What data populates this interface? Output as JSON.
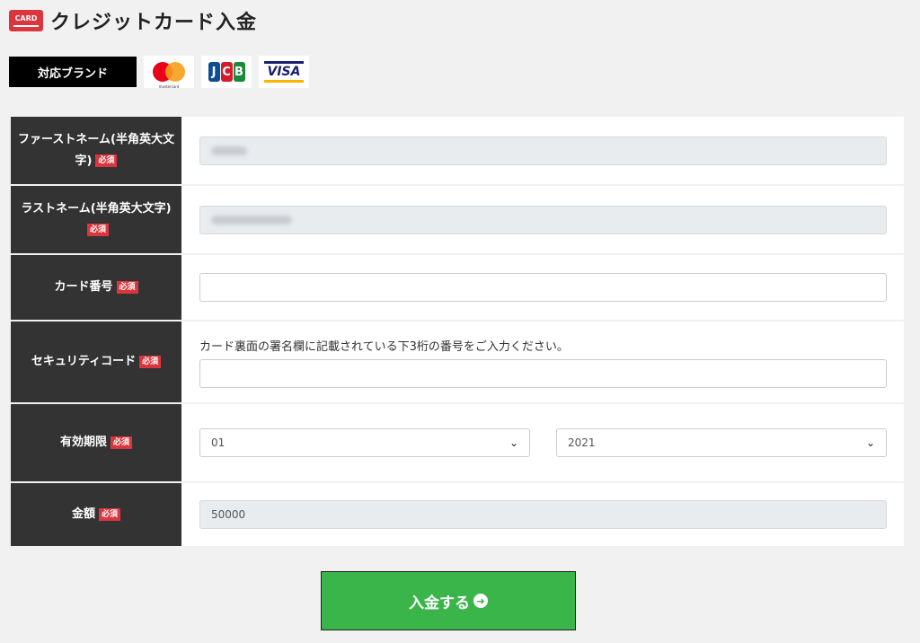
{
  "header": {
    "icon_text": "CARD",
    "title": "クレジットカード入金"
  },
  "brands": {
    "label": "対応ブランド",
    "logos": [
      "mastercard-logo",
      "jcb-logo",
      "visa-logo"
    ],
    "mastercard_text": "mastercard",
    "jcb_text": [
      "J",
      "C",
      "B"
    ],
    "visa_text": "VISA"
  },
  "required": "必須",
  "form": {
    "first_name": {
      "label": "ファーストネーム(半角英大文字)"
    },
    "last_name": {
      "label": "ラストネーム(半角英大文字)"
    },
    "card_number": {
      "label": "カード番号",
      "value": ""
    },
    "security_code": {
      "label": "セキュリティコード",
      "help": "カード裏面の署名欄に記載されている下3桁の番号をご入力ください。",
      "value": ""
    },
    "expiry": {
      "label": "有効期限",
      "month": "01",
      "year": "2021"
    },
    "amount": {
      "label": "金額",
      "value": "50000"
    }
  },
  "submit": {
    "label": "入金する"
  },
  "colors": {
    "accent_red": "#d9363e",
    "label_bg": "#333333",
    "submit_green": "#3ab54a"
  }
}
